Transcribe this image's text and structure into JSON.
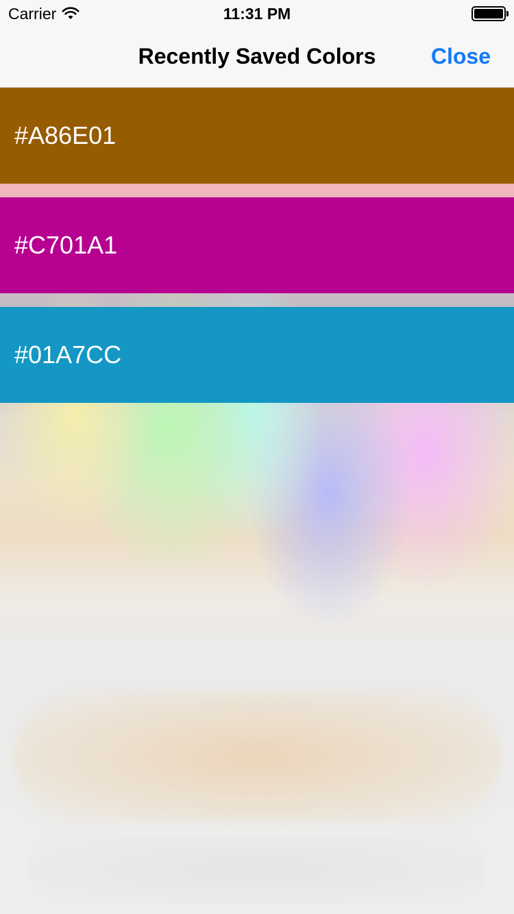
{
  "status_bar": {
    "carrier": "Carrier",
    "time": "11:31 PM",
    "wifi_icon": "wifi-icon",
    "battery_icon": "battery-icon",
    "battery_level": 1.0
  },
  "nav": {
    "title": "Recently Saved Colors",
    "close_label": "Close",
    "accent_color": "#127AFB"
  },
  "saved_colors": [
    {
      "label": "#A86E01",
      "swatch_color": "#965C01"
    },
    {
      "label": "#C701A1",
      "swatch_color": "#B60191"
    },
    {
      "label": "#01A7CC",
      "swatch_color": "#1497C4"
    }
  ]
}
